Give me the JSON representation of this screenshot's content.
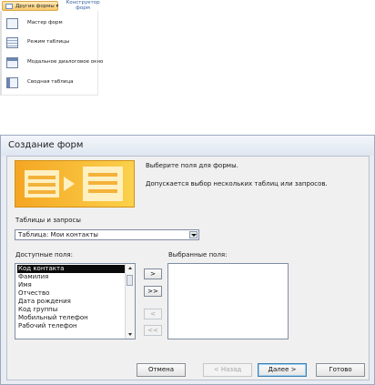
{
  "ribbon": {
    "other_forms_label": "Другие формы",
    "designer_label": "Конструктор форм",
    "menu_items": [
      {
        "label": "Мастер форм",
        "icon": "form-wizard-icon"
      },
      {
        "label": "Режим таблицы",
        "icon": "datasheet-icon"
      },
      {
        "label": "Модальное диалоговое окно",
        "icon": "modal-dialog-icon"
      },
      {
        "label": "Сводная таблица",
        "icon": "pivot-table-icon"
      }
    ]
  },
  "dialog": {
    "title": "Создание форм",
    "info_line1": "Выберите поля для формы.",
    "info_line2": "Допускается выбор нескольких таблиц или запросов.",
    "tables_label": "Таблицы и запросы",
    "tables_combo_value": "Таблица: Мои контакты",
    "available_label": "Доступные поля:",
    "selected_label": "Выбранные поля:",
    "available_fields": [
      "Код контакта",
      "Фамилия",
      "Имя",
      "Отчество",
      "Дата рождения",
      "Код группы",
      "Мобильный телефон",
      "Рабочий телефон"
    ],
    "selected_fields": [],
    "move_buttons": {
      "one": ">",
      "all": ">>",
      "back_one": "<",
      "back_all": "<<"
    },
    "buttons": {
      "cancel": "Отмена",
      "back": "< Назад",
      "next": "Далее >",
      "finish": "Готово"
    }
  },
  "colors": {
    "illustration": "#f5a623",
    "selection": "#0a0a0a",
    "dialog_bg": "#e9ecf3"
  }
}
